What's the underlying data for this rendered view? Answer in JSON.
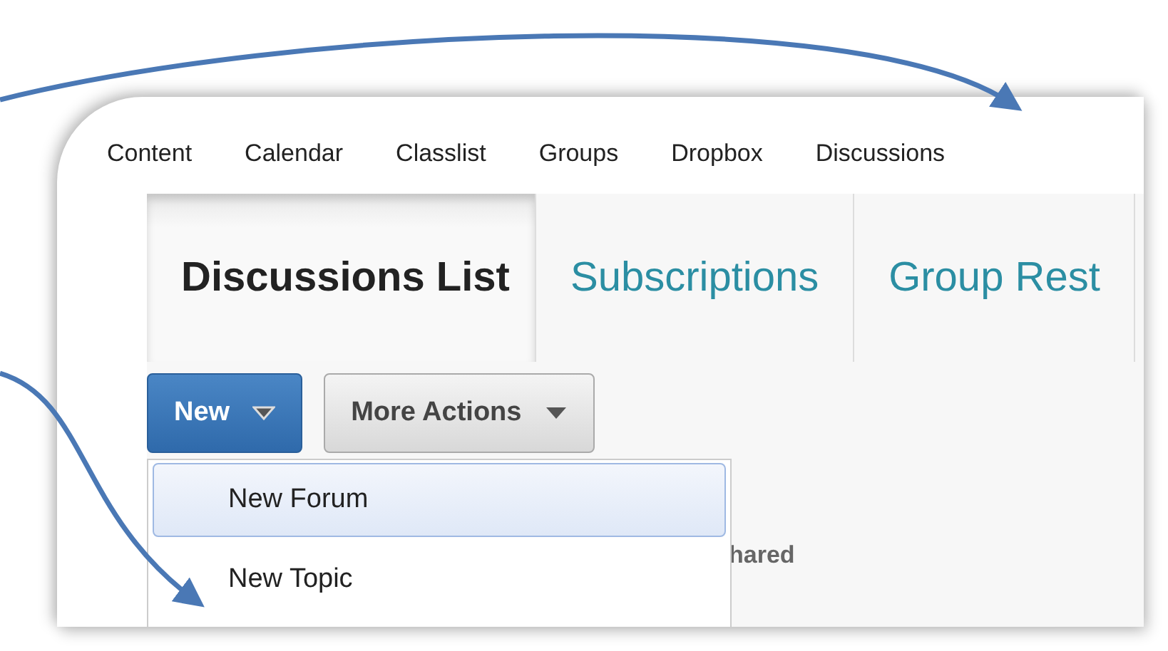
{
  "nav": [
    "Content",
    "Calendar",
    "Classlist",
    "Groups",
    "Dropbox",
    "Discussions"
  ],
  "tabs": [
    {
      "label": "Discussions List",
      "selected": true
    },
    {
      "label": "Subscriptions",
      "selected": false
    },
    {
      "label": "Group Rest",
      "selected": false
    }
  ],
  "buttons": [
    {
      "label": "New",
      "kind": "primary"
    },
    {
      "label": "More Actions",
      "kind": "secondary"
    }
  ],
  "menu": {
    "items": [
      {
        "label": "New Forum",
        "selected": true
      },
      {
        "label": "New Topic",
        "selected": false
      }
    ]
  },
  "content_text": "hared"
}
